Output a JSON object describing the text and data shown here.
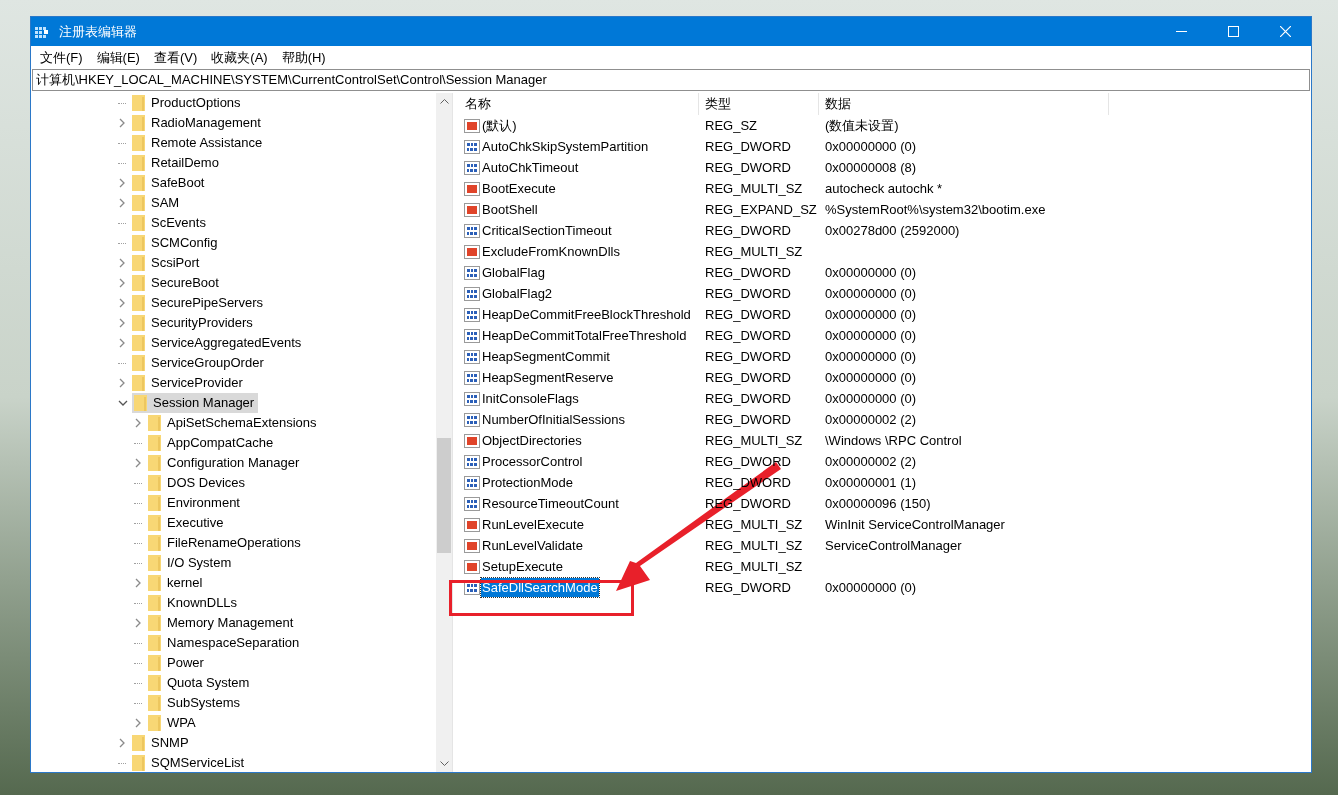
{
  "window": {
    "title": "注册表编辑器"
  },
  "menu": [
    {
      "label": "文件(F)"
    },
    {
      "label": "编辑(E)"
    },
    {
      "label": "查看(V)"
    },
    {
      "label": "收藏夹(A)"
    },
    {
      "label": "帮助(H)"
    }
  ],
  "address": "计算机\\HKEY_LOCAL_MACHINE\\SYSTEM\\CurrentControlSet\\Control\\Session Manager",
  "tree": [
    {
      "label": "ProductOptions",
      "expandable": false,
      "expanded": false,
      "selected": false
    },
    {
      "label": "RadioManagement",
      "expandable": true,
      "expanded": false,
      "selected": false
    },
    {
      "label": "Remote Assistance",
      "expandable": false,
      "expanded": false,
      "selected": false
    },
    {
      "label": "RetailDemo",
      "expandable": false,
      "expanded": false,
      "selected": false
    },
    {
      "label": "SafeBoot",
      "expandable": true,
      "expanded": false,
      "selected": false
    },
    {
      "label": "SAM",
      "expandable": true,
      "expanded": false,
      "selected": false
    },
    {
      "label": "ScEvents",
      "expandable": false,
      "expanded": false,
      "selected": false
    },
    {
      "label": "SCMConfig",
      "expandable": false,
      "expanded": false,
      "selected": false
    },
    {
      "label": "ScsiPort",
      "expandable": true,
      "expanded": false,
      "selected": false
    },
    {
      "label": "SecureBoot",
      "expandable": true,
      "expanded": false,
      "selected": false
    },
    {
      "label": "SecurePipeServers",
      "expandable": true,
      "expanded": false,
      "selected": false
    },
    {
      "label": "SecurityProviders",
      "expandable": true,
      "expanded": false,
      "selected": false
    },
    {
      "label": "ServiceAggregatedEvents",
      "expandable": true,
      "expanded": false,
      "selected": false
    },
    {
      "label": "ServiceGroupOrder",
      "expandable": false,
      "expanded": false,
      "selected": false
    },
    {
      "label": "ServiceProvider",
      "expandable": true,
      "expanded": false,
      "selected": false
    },
    {
      "label": "Session Manager",
      "expandable": true,
      "expanded": true,
      "selected": true,
      "children": [
        {
          "label": "ApiSetSchemaExtensions",
          "expandable": true,
          "expanded": false,
          "selected": false
        },
        {
          "label": "AppCompatCache",
          "expandable": false,
          "expanded": false,
          "selected": false
        },
        {
          "label": "Configuration Manager",
          "expandable": true,
          "expanded": false,
          "selected": false
        },
        {
          "label": "DOS Devices",
          "expandable": false,
          "expanded": false,
          "selected": false
        },
        {
          "label": "Environment",
          "expandable": false,
          "expanded": false,
          "selected": false
        },
        {
          "label": "Executive",
          "expandable": false,
          "expanded": false,
          "selected": false
        },
        {
          "label": "FileRenameOperations",
          "expandable": false,
          "expanded": false,
          "selected": false
        },
        {
          "label": "I/O System",
          "expandable": false,
          "expanded": false,
          "selected": false
        },
        {
          "label": "kernel",
          "expandable": true,
          "expanded": false,
          "selected": false
        },
        {
          "label": "KnownDLLs",
          "expandable": false,
          "expanded": false,
          "selected": false
        },
        {
          "label": "Memory Management",
          "expandable": true,
          "expanded": false,
          "selected": false
        },
        {
          "label": "NamespaceSeparation",
          "expandable": false,
          "expanded": false,
          "selected": false
        },
        {
          "label": "Power",
          "expandable": false,
          "expanded": false,
          "selected": false
        },
        {
          "label": "Quota System",
          "expandable": false,
          "expanded": false,
          "selected": false
        },
        {
          "label": "SubSystems",
          "expandable": false,
          "expanded": false,
          "selected": false
        },
        {
          "label": "WPA",
          "expandable": true,
          "expanded": false,
          "selected": false
        }
      ]
    },
    {
      "label": "SNMP",
      "expandable": true,
      "expanded": false,
      "selected": false
    },
    {
      "label": "SQMServiceList",
      "expandable": false,
      "expanded": false,
      "selected": false
    }
  ],
  "table": {
    "columns": [
      "名称",
      "类型",
      "数据"
    ],
    "rows": [
      {
        "kind": "string",
        "name": "(默认)",
        "type": "REG_SZ",
        "data": "(数值未设置)",
        "selected": false
      },
      {
        "kind": "binary",
        "name": "AutoChkSkipSystemPartition",
        "type": "REG_DWORD",
        "data": "0x00000000 (0)",
        "selected": false
      },
      {
        "kind": "binary",
        "name": "AutoChkTimeout",
        "type": "REG_DWORD",
        "data": "0x00000008 (8)",
        "selected": false
      },
      {
        "kind": "string",
        "name": "BootExecute",
        "type": "REG_MULTI_SZ",
        "data": "autocheck autochk *",
        "selected": false
      },
      {
        "kind": "string",
        "name": "BootShell",
        "type": "REG_EXPAND_SZ",
        "data": "%SystemRoot%\\system32\\bootim.exe",
        "selected": false
      },
      {
        "kind": "binary",
        "name": "CriticalSectionTimeout",
        "type": "REG_DWORD",
        "data": "0x00278d00 (2592000)",
        "selected": false
      },
      {
        "kind": "string",
        "name": "ExcludeFromKnownDlls",
        "type": "REG_MULTI_SZ",
        "selected": false
      },
      {
        "kind": "binary",
        "name": "GlobalFlag",
        "type": "REG_DWORD",
        "data": "0x00000000 (0)",
        "selected": false
      },
      {
        "kind": "binary",
        "name": "GlobalFlag2",
        "type": "REG_DWORD",
        "data": "0x00000000 (0)",
        "selected": false
      },
      {
        "kind": "binary",
        "name": "HeapDeCommitFreeBlockThreshold",
        "type": "REG_DWORD",
        "data": "0x00000000 (0)",
        "selected": false
      },
      {
        "kind": "binary",
        "name": "HeapDeCommitTotalFreeThreshold",
        "type": "REG_DWORD",
        "data": "0x00000000 (0)",
        "selected": false
      },
      {
        "kind": "binary",
        "name": "HeapSegmentCommit",
        "type": "REG_DWORD",
        "data": "0x00000000 (0)",
        "selected": false
      },
      {
        "kind": "binary",
        "name": "HeapSegmentReserve",
        "type": "REG_DWORD",
        "data": "0x00000000 (0)",
        "selected": false
      },
      {
        "kind": "binary",
        "name": "InitConsoleFlags",
        "type": "REG_DWORD",
        "data": "0x00000000 (0)",
        "selected": false
      },
      {
        "kind": "binary",
        "name": "NumberOfInitialSessions",
        "type": "REG_DWORD",
        "data": "0x00000002 (2)",
        "selected": false
      },
      {
        "kind": "string",
        "name": "ObjectDirectories",
        "type": "REG_MULTI_SZ",
        "data": "\\Windows \\RPC Control",
        "selected": false
      },
      {
        "kind": "binary",
        "name": "ProcessorControl",
        "type": "REG_DWORD",
        "data": "0x00000002 (2)",
        "selected": false
      },
      {
        "kind": "binary",
        "name": "ProtectionMode",
        "type": "REG_DWORD",
        "data": "0x00000001 (1)",
        "selected": false
      },
      {
        "kind": "binary",
        "name": "ResourceTimeoutCount",
        "type": "REG_DWORD",
        "data": "0x00000096 (150)",
        "selected": false
      },
      {
        "kind": "string",
        "name": "RunLevelExecute",
        "type": "REG_MULTI_SZ",
        "data": "WinInit ServiceControlManager",
        "selected": false
      },
      {
        "kind": "string",
        "name": "RunLevelValidate",
        "type": "REG_MULTI_SZ",
        "data": "ServiceControlManager",
        "selected": false
      },
      {
        "kind": "string",
        "name": "SetupExecute",
        "type": "REG_MULTI_SZ",
        "selected": false
      },
      {
        "kind": "binary",
        "name": "SafeDllSearchMode",
        "type": "REG_DWORD",
        "data": "0x00000000 (0)",
        "selected": true
      }
    ]
  }
}
